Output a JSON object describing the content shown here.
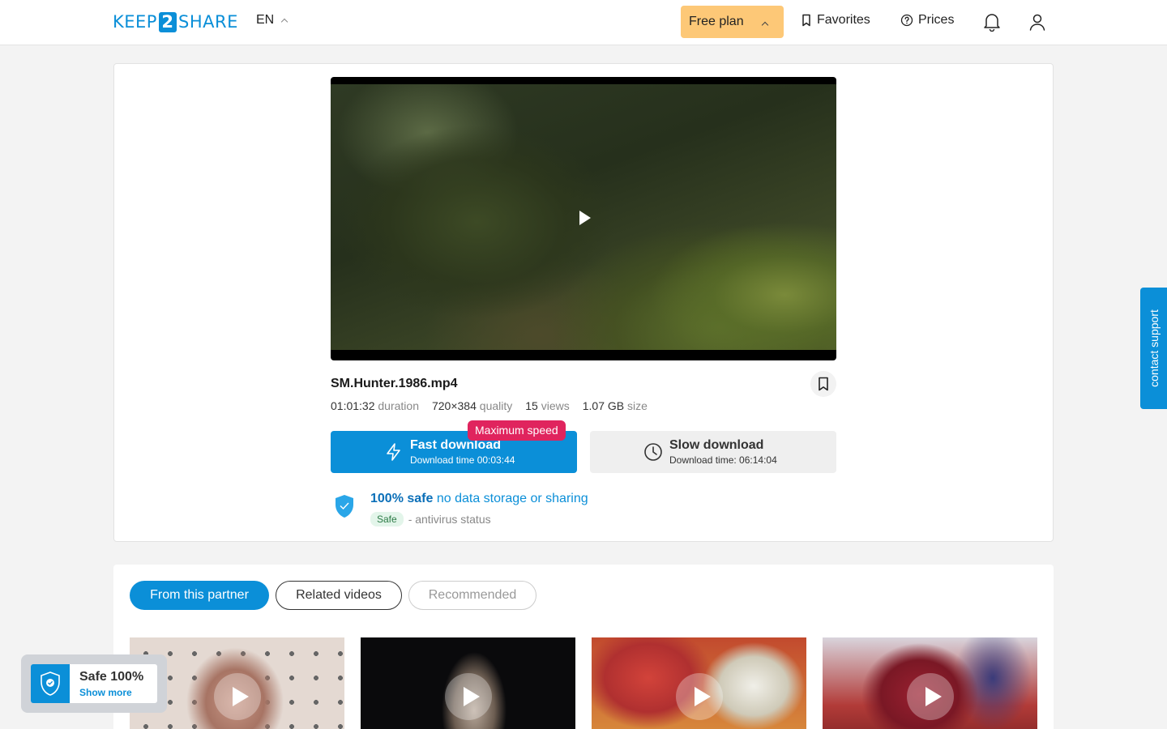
{
  "header": {
    "logo_left": "KEEP",
    "logo_mid": "2",
    "logo_right": "SHARE",
    "lang": "EN",
    "free_plan": "Free plan",
    "favorites": "Favorites",
    "prices": "Prices"
  },
  "file": {
    "name": "SM.Hunter.1986.mp4",
    "duration": "01:01:32",
    "duration_label": "duration",
    "quality": "720×384",
    "quality_label": "quality",
    "views": "15",
    "views_label": "views",
    "size": "1.07 GB",
    "size_label": "size"
  },
  "downloads": {
    "badge": "Maximum speed",
    "fast_title": "Fast download",
    "fast_sub": "Download time 00:03:44",
    "slow_title": "Slow download",
    "slow_sub": "Download time: 06:14:04"
  },
  "safety": {
    "strong": "100% safe",
    "rest": "no data storage or sharing",
    "badge": "Safe",
    "av_text": "- antivirus status"
  },
  "tabs": {
    "partner": "From this partner",
    "related": "Related videos",
    "recommended": "Recommended"
  },
  "widget": {
    "title": "Safe 100%",
    "link": "Show more"
  },
  "contact": "contact support",
  "colors": {
    "accent": "#0b8fd8",
    "badge_red": "#e0245e",
    "plan_orange": "#fdc877"
  }
}
